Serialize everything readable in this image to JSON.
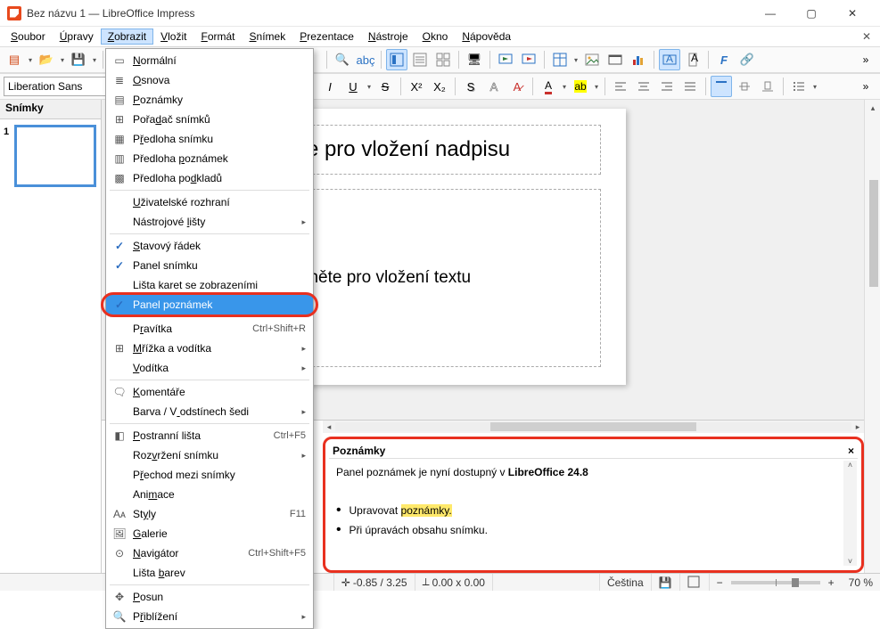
{
  "window": {
    "title": "Bez názvu 1 — LibreOffice Impress"
  },
  "menus": [
    "Soubor",
    "Úpravy",
    "Zobrazit",
    "Vložit",
    "Formát",
    "Snímek",
    "Prezentace",
    "Nástroje",
    "Okno",
    "Nápověda"
  ],
  "menu_underline": [
    0,
    0,
    0,
    0,
    0,
    0,
    0,
    0,
    0,
    0
  ],
  "view_menu": {
    "items": [
      {
        "label": "Normální",
        "icon": "layout",
        "u": 0
      },
      {
        "label": "Osnova",
        "icon": "outline",
        "u": 0
      },
      {
        "label": "Poznámky",
        "icon": "notes",
        "u": 0
      },
      {
        "label": "Pořadač snímků",
        "icon": "sorter",
        "u": 4
      },
      {
        "label": "Předloha snímku",
        "icon": "master",
        "u": 1
      },
      {
        "label": "Předloha poznámek",
        "icon": "master-notes",
        "u": 9
      },
      {
        "label": "Předloha podkladů",
        "icon": "master-handout",
        "u": 11
      },
      {
        "sep": true
      },
      {
        "label": "Uživatelské rozhraní",
        "u": 0
      },
      {
        "label": "Nástrojové lišty",
        "u": 11,
        "sub": true
      },
      {
        "sep": true
      },
      {
        "label": "Stavový řádek",
        "u": 0,
        "check": true
      },
      {
        "label": "Panel snímku",
        "check": true
      },
      {
        "label": "Lišta karet se zobrazeními"
      },
      {
        "label": "Panel poznámek",
        "check": true,
        "highlighted": true,
        "ring": true
      },
      {
        "sep": true
      },
      {
        "label": "Pravítka",
        "u": 1,
        "accel": "Ctrl+Shift+R"
      },
      {
        "label": "Mřížka a vodítka",
        "icon": "grid",
        "u": 0,
        "sub": true
      },
      {
        "label": "Vodítka",
        "u": 0,
        "sub": true
      },
      {
        "sep": true
      },
      {
        "label": "Komentáře",
        "icon": "comment",
        "u": 0
      },
      {
        "label": "Barva / V odstínech šedi",
        "u": 9,
        "sub": true
      },
      {
        "sep": true
      },
      {
        "label": "Postranní lišta",
        "icon": "sidepanel",
        "u": 0,
        "accel": "Ctrl+F5"
      },
      {
        "label": "Rozvržení snímku",
        "u": 3,
        "sub": true
      },
      {
        "label": "Přechod mezi snímky",
        "u": 1
      },
      {
        "label": "Animace",
        "u": 3
      },
      {
        "label": "Styly",
        "icon": "styles",
        "u": 2,
        "accel": "F11"
      },
      {
        "label": "Galerie",
        "icon": "gallery",
        "u": 0
      },
      {
        "label": "Navigátor",
        "icon": "navigator",
        "u": 0,
        "accel": "Ctrl+Shift+F5"
      },
      {
        "label": "Lišta barev",
        "u": 6
      },
      {
        "sep": true
      },
      {
        "label": "Posun",
        "icon": "pan",
        "u": 0
      },
      {
        "label": "Přiblížení",
        "icon": "zoom",
        "u": 1,
        "sub": true
      }
    ]
  },
  "font": {
    "name": "Liberation Sans"
  },
  "sidebar": {
    "header": "Snímky",
    "slide_num": "1"
  },
  "slide": {
    "title_placeholder": "Klikněte pro vložení nadpisu",
    "content_placeholder": "Klikněte pro vložení textu"
  },
  "notes": {
    "header": "Poznámky",
    "line1_a": "Panel poznámek je nyní dostupný v ",
    "line1_b": "LibreOffice 24.8",
    "bullet1_a": "Upravovat ",
    "bullet1_hl": "poznámky.",
    "bullet2": "Při úpravách obsahu snímku."
  },
  "status": {
    "coords": "-0.85 / 3.25",
    "size": "0.00 x 0.00",
    "lang": "Čeština",
    "zoom": "70 %"
  }
}
